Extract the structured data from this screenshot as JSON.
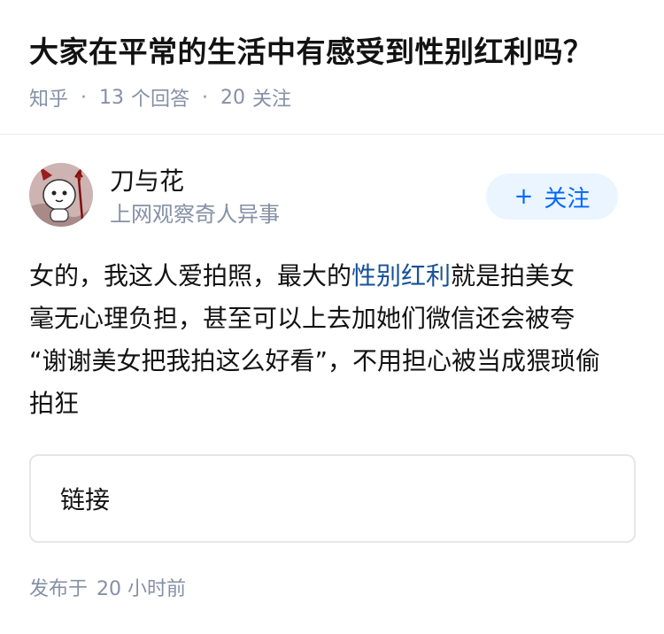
{
  "question": {
    "title": "大家在平常的生活中有感受到性别红利吗？",
    "meta": {
      "source": "知乎",
      "answers_count": "13",
      "answers_label": "个回答",
      "followers_count": "20",
      "followers_label": "关注"
    }
  },
  "author": {
    "name": "刀与花",
    "bio": "上网观察奇人异事",
    "avatar_icon": "cat-devil-avatar",
    "follow_label": "关注"
  },
  "answer": {
    "line1_pre": "女的，我这人爱拍照，最大的",
    "line1_link": "性别红利",
    "line1_post": "就是拍美女",
    "line2": "毫无心理负担，甚至可以上去加她们微信还会被夸",
    "line3": "“谢谢美女把我拍这么好看”，不用担心被当成猥琐偷",
    "line4": "拍狂",
    "link_color": "#175199"
  },
  "link_card": {
    "label": "链接"
  },
  "footer": {
    "published_label": "发布于",
    "published_time": "20 小时前"
  },
  "colors": {
    "accent": "#0066ff",
    "muted": "#8590a6",
    "follow_bg": "#ebf5ff"
  }
}
